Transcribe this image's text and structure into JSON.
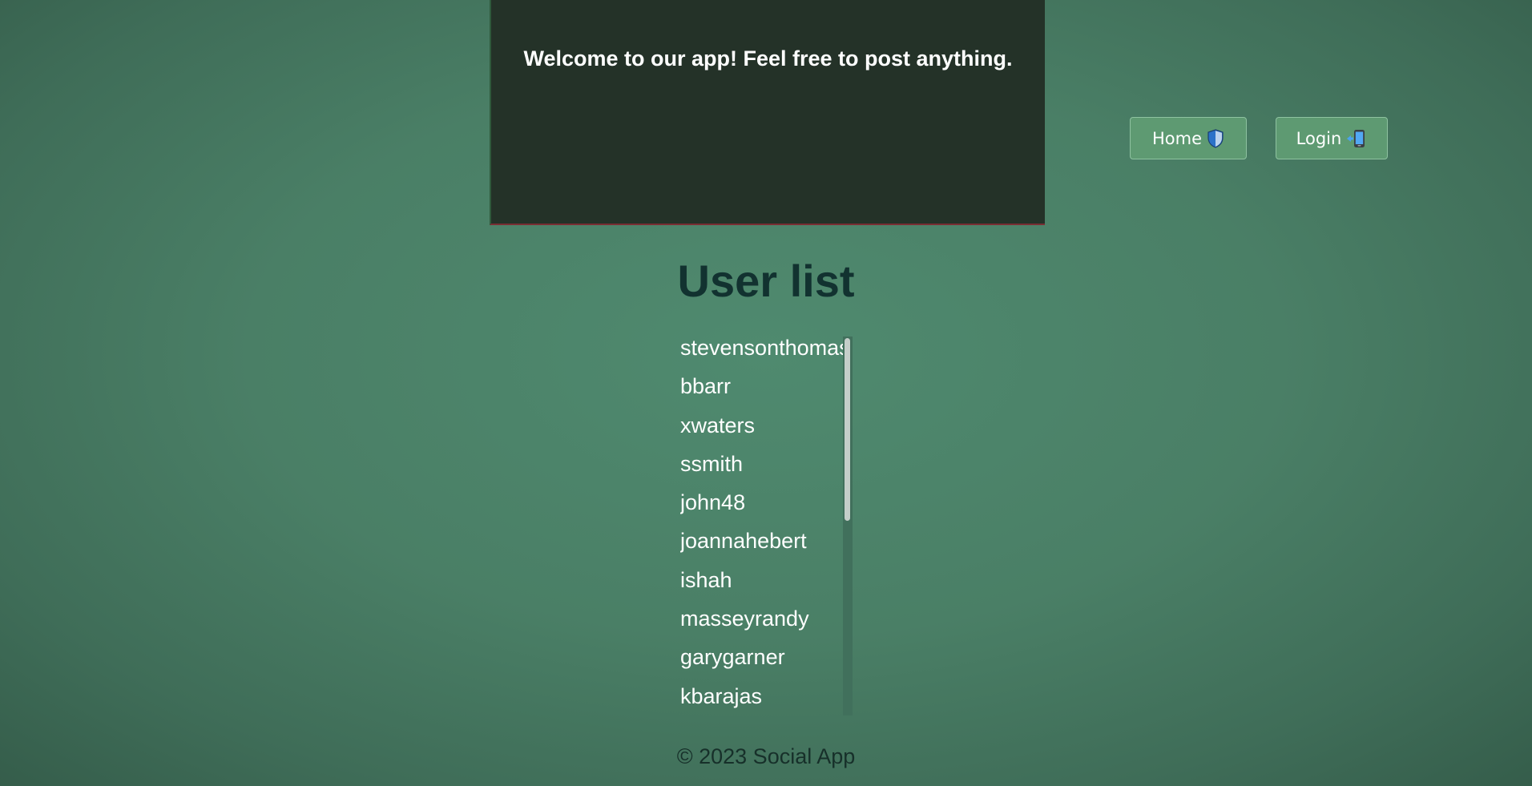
{
  "header": {
    "welcome_text": "Welcome to our app! Feel free to post anything.",
    "nav": {
      "home_label": "Home",
      "home_icon": "shield-icon",
      "login_label": "Login",
      "login_icon": "mobile-phone-arrow-icon"
    }
  },
  "main": {
    "title": "User list",
    "users": [
      "stevensonthomas",
      "bbarr",
      "xwaters",
      "ssmith",
      "john48",
      "joannahebert",
      "ishah",
      "masseyrandy",
      "garygarner",
      "kbarajas"
    ]
  },
  "footer": {
    "text": "© 2023 Social App"
  },
  "colors": {
    "background": "#4a7f66",
    "header_bg": "#243228",
    "button_bg": "#5e9a72",
    "title_color": "#123230"
  }
}
